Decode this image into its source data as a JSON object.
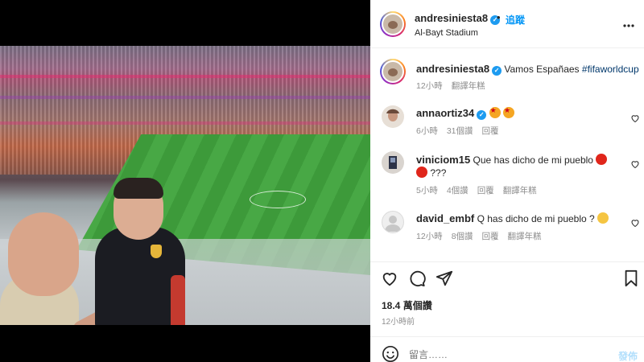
{
  "post": {
    "author": "andresiniesta8",
    "follow_label": "追蹤",
    "location": "Al-Bayt Stadium",
    "more_icon": "more-options-icon",
    "separator": "•"
  },
  "caption": {
    "username": "andresiniesta8",
    "text": "Vamos Españaes",
    "hashtag": "#fifaworldcup",
    "time": "12小時",
    "translate": "翻譯年糕"
  },
  "comments": [
    {
      "username": "annaortiz34",
      "text": "",
      "emoji": [
        "star-struck",
        "star-struck"
      ],
      "time": "6小時",
      "likes": "31個讚",
      "reply": "回覆",
      "translate": ""
    },
    {
      "username": "viniciom15",
      "text": "Que has dicho de mi pueblo",
      "text2": "???",
      "emoji": [
        "angry"
      ],
      "time": "5小時",
      "likes": "4個讚",
      "reply": "回覆",
      "translate": "翻譯年糕"
    },
    {
      "username": "david_embf",
      "text": "Q has dicho de mi pueblo ?",
      "emoji": [
        "smile"
      ],
      "time": "12小時",
      "likes": "8個讚",
      "reply": "回覆",
      "translate": "翻譯年糕"
    }
  ],
  "actions": {
    "likes_count": "18.4 萬個讚",
    "posted_time": "12小時前"
  },
  "composer": {
    "placeholder": "留言……",
    "post_label": "發佈"
  },
  "colors": {
    "accent": "#0095f6",
    "muted": "#8e8e8e",
    "verified": "#1d9bf0"
  }
}
